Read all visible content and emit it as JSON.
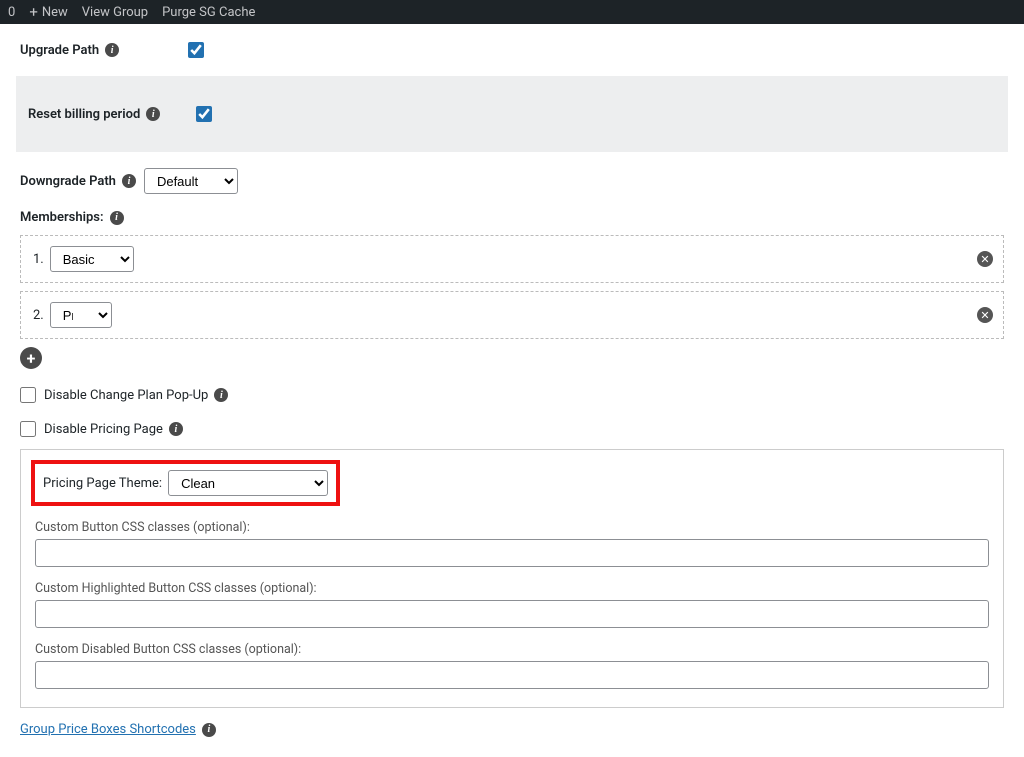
{
  "adminbar": {
    "zero": "0",
    "new": "New",
    "view_group": "View Group",
    "purge": "Purge SG Cache"
  },
  "labels": {
    "upgrade_path": "Upgrade Path",
    "reset_billing": "Reset billing period",
    "downgrade_path": "Downgrade Path",
    "memberships": "Memberships:",
    "disable_popup": "Disable Change Plan Pop-Up",
    "disable_pricing": "Disable Pricing Page",
    "pricing_theme": "Pricing Page Theme:",
    "custom_btn": "Custom Button CSS classes (optional):",
    "custom_hl_btn": "Custom Highlighted Button CSS classes (optional):",
    "custom_dis_btn": "Custom Disabled Button CSS classes (optional):",
    "shortcodes": "Group Price Boxes Shortcodes"
  },
  "values": {
    "downgrade_select": "Default",
    "membership1_num": "1.",
    "membership1": "Basic",
    "membership2_num": "2.",
    "membership2": "Pro",
    "theme": "Clean"
  }
}
